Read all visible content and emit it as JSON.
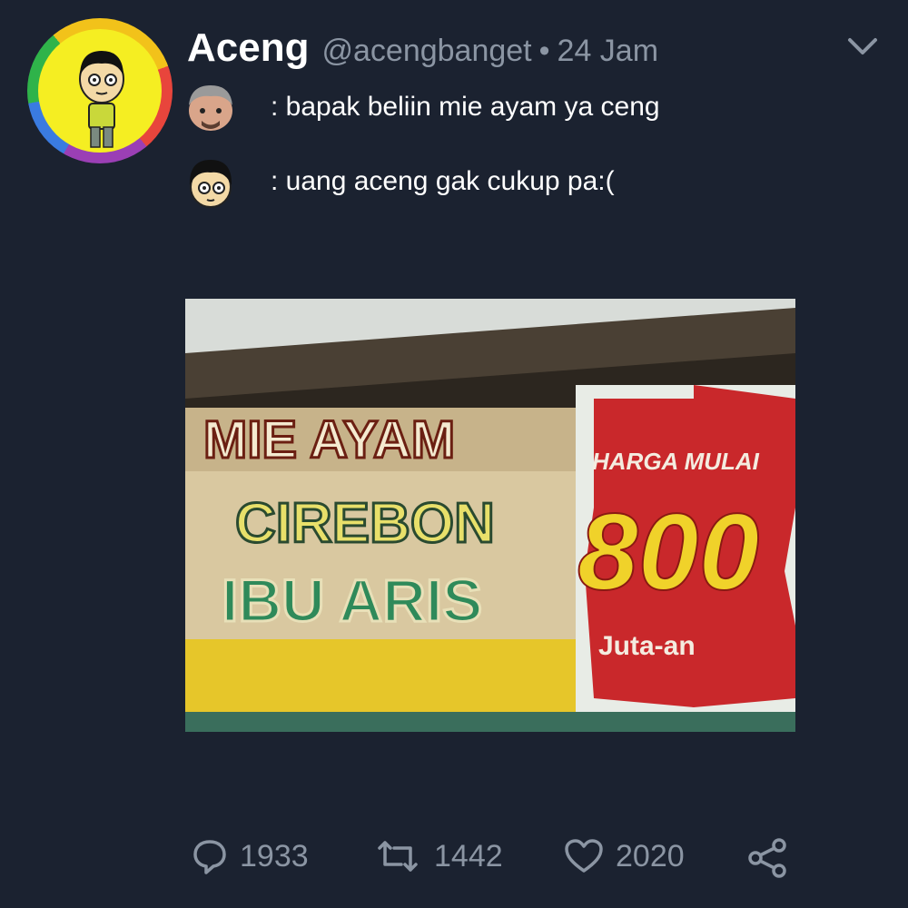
{
  "tweet": {
    "author_name": "Aceng",
    "author_handle": "@acengbanget",
    "separator": "•",
    "timestamp": "24 Jam",
    "lines": [
      {
        "speaker_icon": "dad-face-icon",
        "text": ": bapak beliin mie ayam ya ceng"
      },
      {
        "speaker_icon": "aceng-face-icon",
        "text": ": uang aceng gak cukup pa:("
      }
    ]
  },
  "photo": {
    "sign_left_line1": "MIE AYAM",
    "sign_left_line2": "CIREBON",
    "sign_left_line3": "IBU ARIS",
    "sign_right_top": "HARGA MULAI",
    "sign_right_price": "800",
    "sign_right_bottom": "Juta-an"
  },
  "stats": {
    "replies": "1933",
    "retweets": "1442",
    "likes": "2020"
  },
  "colors": {
    "background": "#1b2230",
    "muted": "#8b95a3",
    "text": "#ffffff"
  }
}
